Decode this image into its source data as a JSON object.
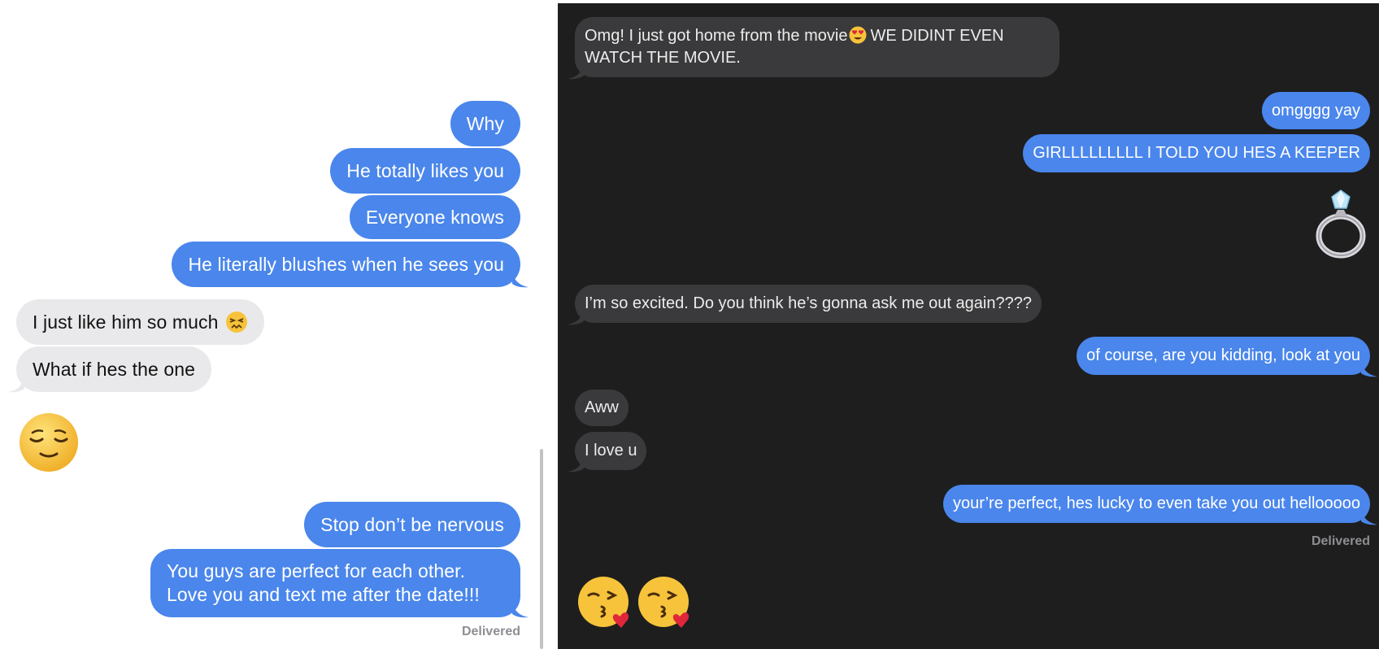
{
  "left_thread": {
    "messages": [
      {
        "text": "Why",
        "direction": "sent"
      },
      {
        "text": "He totally likes you",
        "direction": "sent"
      },
      {
        "text": "Everyone knows",
        "direction": "sent"
      },
      {
        "text": "He literally blushes when he sees you",
        "direction": "sent"
      },
      {
        "text": "I just like him so much",
        "direction": "received",
        "emoji": "confounded-face"
      },
      {
        "text": "What if hes the one",
        "direction": "received"
      },
      {
        "emoji": "relieved-face",
        "direction": "received"
      },
      {
        "text": "Stop don’t be nervous",
        "direction": "sent"
      },
      {
        "text": "You guys are perfect for each other. Love you and text me after the date!!!",
        "direction": "sent"
      }
    ],
    "status": "Delivered"
  },
  "right_thread": {
    "messages": [
      {
        "text": "Omg! I just got home from the movie",
        "text2": "WE DIDINT EVEN WATCH THE MOVIE.",
        "direction": "received",
        "emoji": "heart-eyes-face"
      },
      {
        "text": "omgggg yay",
        "direction": "sent"
      },
      {
        "text": "GIRLLLLLLLLL I TOLD YOU HES A KEEPER",
        "direction": "sent"
      },
      {
        "emoji": "ring",
        "direction": "sent"
      },
      {
        "text": "I’m so excited. Do you think he’s gonna ask me out again????",
        "direction": "received"
      },
      {
        "text": "of course, are you kidding, look at you",
        "direction": "sent"
      },
      {
        "text": "Aww",
        "direction": "received"
      },
      {
        "text": "I love u",
        "direction": "received"
      },
      {
        "text": "your’re perfect, hes lucky to even take you out hellooooo",
        "direction": "sent"
      },
      {
        "emoji": "kissing-face-with-heart",
        "direction": "received"
      },
      {
        "emoji": "kissing-face-with-heart",
        "direction": "received"
      }
    ],
    "status": "Delivered"
  },
  "colors": {
    "sent_bubble": "#4a86eb",
    "received_bubble_light": "#e9e9eb",
    "received_bubble_dark": "#3a3a3c",
    "dark_background": "#1e1e1e"
  }
}
